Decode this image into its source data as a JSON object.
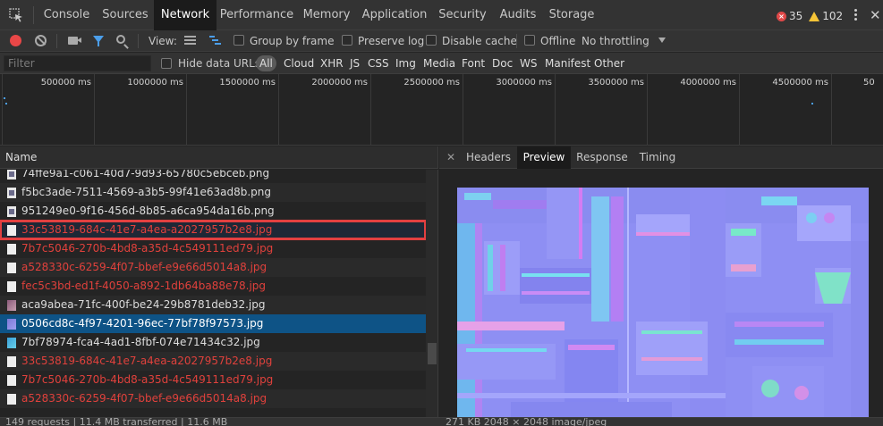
{
  "topbar": {
    "tabs": [
      {
        "label": "Console"
      },
      {
        "label": "Sources"
      },
      {
        "label": "Network"
      },
      {
        "label": "Performance"
      },
      {
        "label": "Memory"
      },
      {
        "label": "Application"
      },
      {
        "label": "Security"
      },
      {
        "label": "Audits"
      },
      {
        "label": "Storage"
      }
    ],
    "active_tab": "Network",
    "error_count": "35",
    "warning_count": "102"
  },
  "toolbar": {
    "view_label": "View:",
    "group_by_frame": "Group by frame",
    "preserve_log": "Preserve log",
    "disable_cache": "Disable cache",
    "offline": "Offline",
    "throttling": "No throttling"
  },
  "filterbar": {
    "placeholder": "Filter",
    "hide_data_urls": "Hide data URLs",
    "types": [
      "All",
      "Cloud",
      "XHR",
      "JS",
      "CSS",
      "Img",
      "Media",
      "Font",
      "Doc",
      "WS",
      "Manifest",
      "Other"
    ]
  },
  "overview": {
    "ticks": [
      "500000 ms",
      "1000000 ms",
      "1500000 ms",
      "2000000 ms",
      "2500000 ms",
      "3000000 ms",
      "3500000 ms",
      "4000000 ms",
      "4500000 ms",
      "50"
    ]
  },
  "list": {
    "header": "Name",
    "rows": [
      {
        "name": "74ffe9a1-c061-40d7-9d93-65780c5ebceb.png",
        "state": "normal"
      },
      {
        "name": "f5bc3ade-7511-4569-a3b5-99f41e63ad8b.png",
        "state": "normal"
      },
      {
        "name": "951249e0-9f16-456d-8b85-a6ca954da16b.png",
        "state": "normal"
      },
      {
        "name": "33c53819-684c-41e7-a4ea-a2027957b2e8.jpg",
        "state": "error-highlight"
      },
      {
        "name": "7b7c5046-270b-4bd8-a35d-4c549111ed79.jpg",
        "state": "error"
      },
      {
        "name": "a528330c-6259-4f07-bbef-e9e66d5014a8.jpg",
        "state": "error"
      },
      {
        "name": "fec5c3bd-ed1f-4050-a892-1db64ba88e78.jpg",
        "state": "error"
      },
      {
        "name": "aca9abea-71fc-400f-be24-29b8781deb32.jpg",
        "state": "normal"
      },
      {
        "name": "0506cd8c-4f97-4201-96ec-77bf78f97573.jpg",
        "state": "selected"
      },
      {
        "name": "7bf78974-fca4-4ad1-8fbf-074e71434c32.jpg",
        "state": "normal"
      },
      {
        "name": "33c53819-684c-41e7-a4ea-a2027957b2e8.jpg",
        "state": "error"
      },
      {
        "name": "7b7c5046-270b-4bd8-a35d-4c549111ed79.jpg",
        "state": "error"
      },
      {
        "name": "a528330c-6259-4f07-bbef-e9e66d5014a8.jpg",
        "state": "error"
      }
    ]
  },
  "status": {
    "text": "149 requests | 11.4 MB transferred | 11.6 MB"
  },
  "details": {
    "tabs": [
      {
        "label": "Headers"
      },
      {
        "label": "Preview"
      },
      {
        "label": "Response"
      },
      {
        "label": "Timing"
      }
    ],
    "active_tab": "Preview",
    "info": "271 KB   2048 × 2048   image/jpeg"
  },
  "colors": {
    "accent": "#0e5386",
    "error_text": "#e0413c",
    "highlight_border": "#e24040",
    "record": "#e94747"
  }
}
